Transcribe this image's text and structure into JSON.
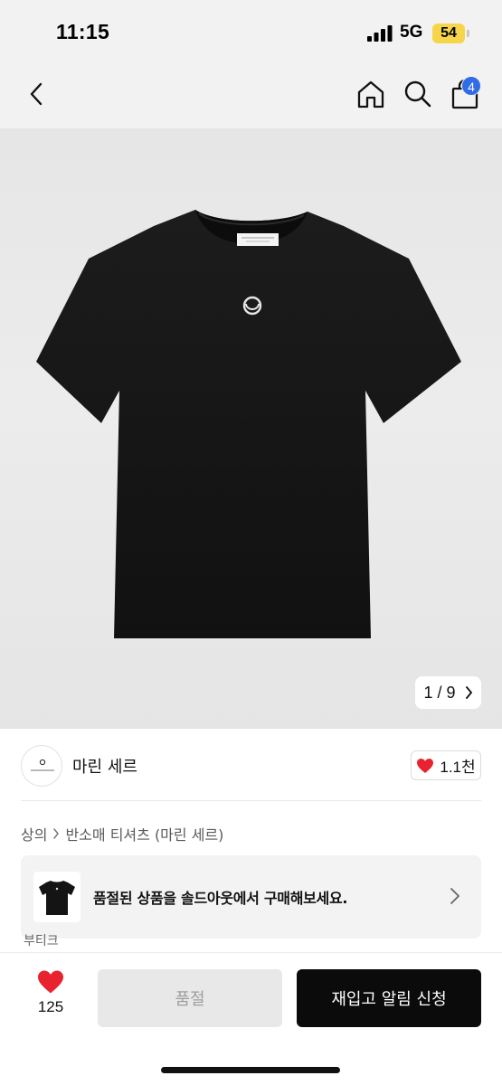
{
  "status_bar": {
    "time": "11:15",
    "network": "5G",
    "battery": "54"
  },
  "nav": {
    "cart_count": "4"
  },
  "product": {
    "image_counter": "1 / 9",
    "brand_name": "마린 세르",
    "like_count": "1.1천"
  },
  "breadcrumb": {
    "category": "상의",
    "subcategory": "반소매 티셔츠 (마린 세르)"
  },
  "soldout_banner": {
    "text": "품절된 상품을 솔드아웃에서 구매해보세요."
  },
  "peek_label": "부티크",
  "bottom_bar": {
    "wish_count": "125",
    "soldout_label": "품절",
    "restock_label": "재입고 알림 신청"
  },
  "colors": {
    "accent_blue": "#2f6ce5",
    "heart_red": "#e8232f",
    "battery_yellow": "#f7d54a",
    "cta_black": "#0b0b0b"
  }
}
